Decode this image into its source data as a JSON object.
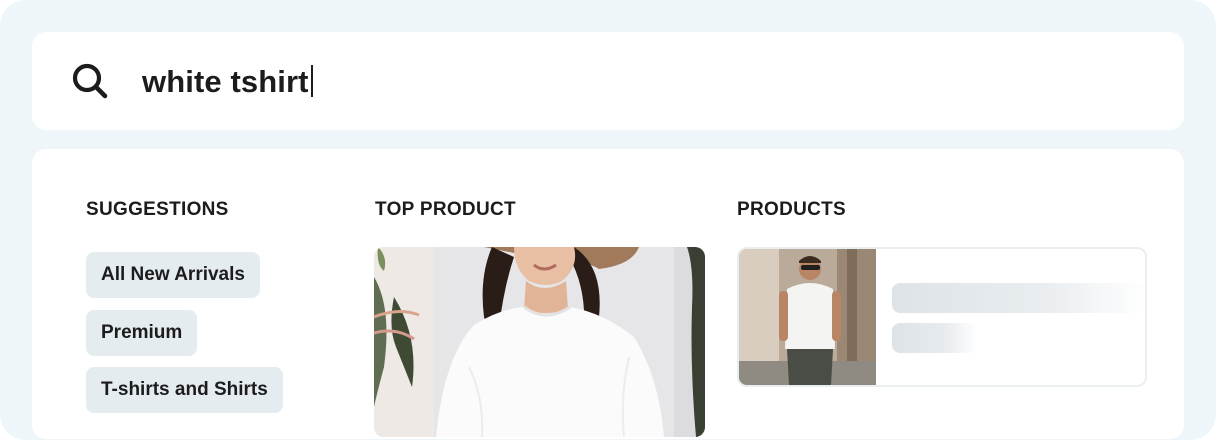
{
  "search": {
    "query": "white tshirt"
  },
  "suggestions": {
    "heading": "SUGGESTIONS",
    "items": [
      {
        "label": "All New Arrivals"
      },
      {
        "label": "Premium"
      },
      {
        "label": "T-shirts and Shirts"
      }
    ]
  },
  "top_product": {
    "heading": "TOP PRODUCT",
    "image": "woman-in-white-tshirt-with-sun-hat"
  },
  "products": {
    "heading": "PRODUCTS",
    "items": [
      {
        "image": "man-in-white-tshirt-with-sunglasses",
        "loading": true
      }
    ]
  },
  "colors": {
    "background": "#eef6fa",
    "card": "#ffffff",
    "chip": "#e5ecf0",
    "text": "#1c1c1e"
  }
}
